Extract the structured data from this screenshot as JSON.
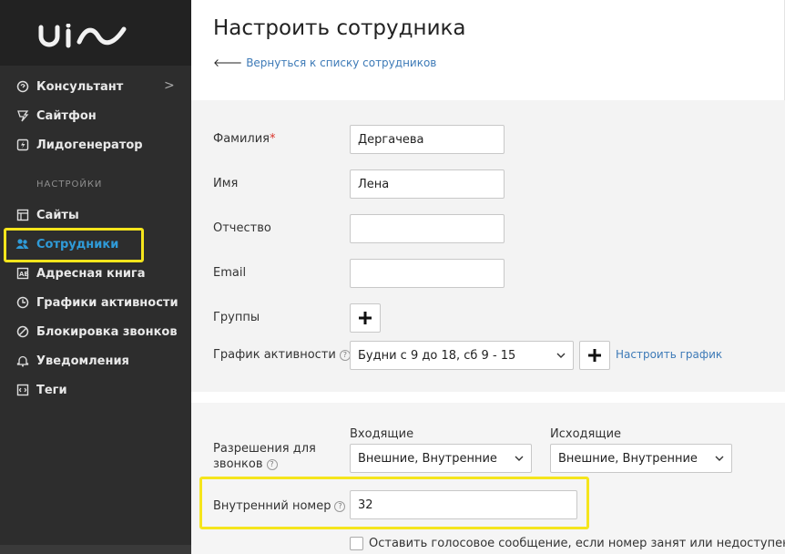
{
  "sidebar": {
    "logo_text": "uiw",
    "items_top": [
      {
        "label": "Консультант",
        "icon": "chat-icon"
      },
      {
        "label": "Сайтфон",
        "icon": "phone-icon"
      },
      {
        "label": "Лидогенератор",
        "icon": "lightning-icon"
      }
    ],
    "chevron": ">",
    "section_label": "НАСТРОЙКИ",
    "items_settings": [
      {
        "label": "Сайты",
        "icon": "site-icon"
      },
      {
        "label": "Сотрудники",
        "icon": "users-icon",
        "active": true
      },
      {
        "label": "Адресная книга",
        "icon": "address-book-icon"
      },
      {
        "label": "Графики активности",
        "icon": "clock-icon"
      },
      {
        "label": "Блокировка звонков",
        "icon": "block-icon"
      },
      {
        "label": "Уведомления",
        "icon": "bell-icon"
      },
      {
        "label": "Теги",
        "icon": "tag-icon"
      }
    ],
    "active_color": "#2f9bd8"
  },
  "page": {
    "title": "Настроить сотрудника",
    "back_link": "Вернуться к списку сотрудников"
  },
  "form": {
    "lastname_label": "Фамилия",
    "required_mark": "*",
    "lastname_value": "Дергачева",
    "firstname_label": "Имя",
    "firstname_value": "Лена",
    "middlename_label": "Отчество",
    "middlename_value": "",
    "email_label": "Email",
    "email_value": "",
    "groups_label": "Группы",
    "schedule_label": "График активности",
    "schedule_value": "Будни с 9 до 18, сб 9 - 15",
    "schedule_link": "Настроить график",
    "help_glyph": "?"
  },
  "calls": {
    "permissions_label_1": "Разрешения для",
    "permissions_label_2": "звонков",
    "incoming_header": "Входящие",
    "incoming_value": "Внешние, Внутренние",
    "outgoing_header": "Исходящие",
    "outgoing_value": "Внешние, Внутренние",
    "extension_label": "Внутренний номер",
    "extension_value": "32",
    "voicemail_label": "Оставить голосовое сообщение, если номер занят или недоступен"
  },
  "colors": {
    "highlight": "#f5e51c",
    "link": "#3d7ab7",
    "sidebar_bg": "#2d2d2d"
  }
}
